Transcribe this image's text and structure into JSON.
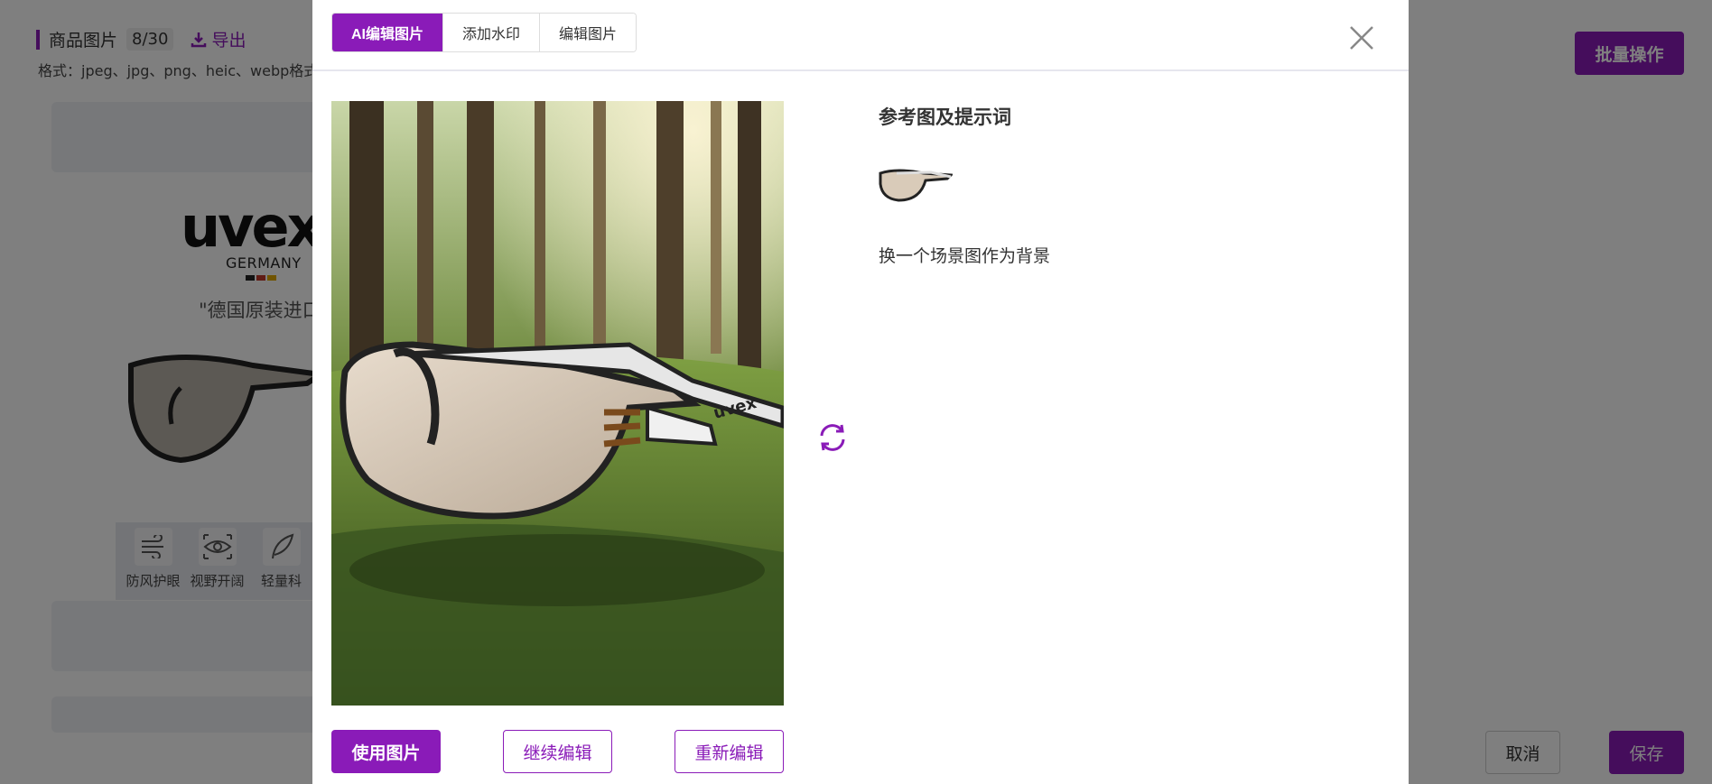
{
  "background": {
    "section_title": "商品图片",
    "count": "8/30",
    "export_label": "导出",
    "format_text": "格式：jpeg、jpg、png、heic、webp格式",
    "brand_logo": "uvex",
    "brand_country": "GERMANY",
    "tagline": "\"德国原装进口",
    "features": [
      {
        "label": "防风护眼",
        "icon": "wind-icon"
      },
      {
        "label": "视野开阔",
        "icon": "eye-icon"
      },
      {
        "label": "轻量科",
        "icon": "feather-icon"
      }
    ],
    "batch_button": "批量操作",
    "cancel_button": "取消",
    "save_button": "保存"
  },
  "modal": {
    "tabs": [
      {
        "label": "AI编辑图片",
        "active": true
      },
      {
        "label": "添加水印",
        "active": false
      },
      {
        "label": "编辑图片",
        "active": false
      }
    ],
    "ref_title": "参考图及提示词",
    "prompt": "换一个场景图作为背景",
    "buttons": {
      "use": "使用图片",
      "continue": "继续编辑",
      "redo": "重新编辑"
    },
    "accent_color": "#8a1bb8"
  }
}
